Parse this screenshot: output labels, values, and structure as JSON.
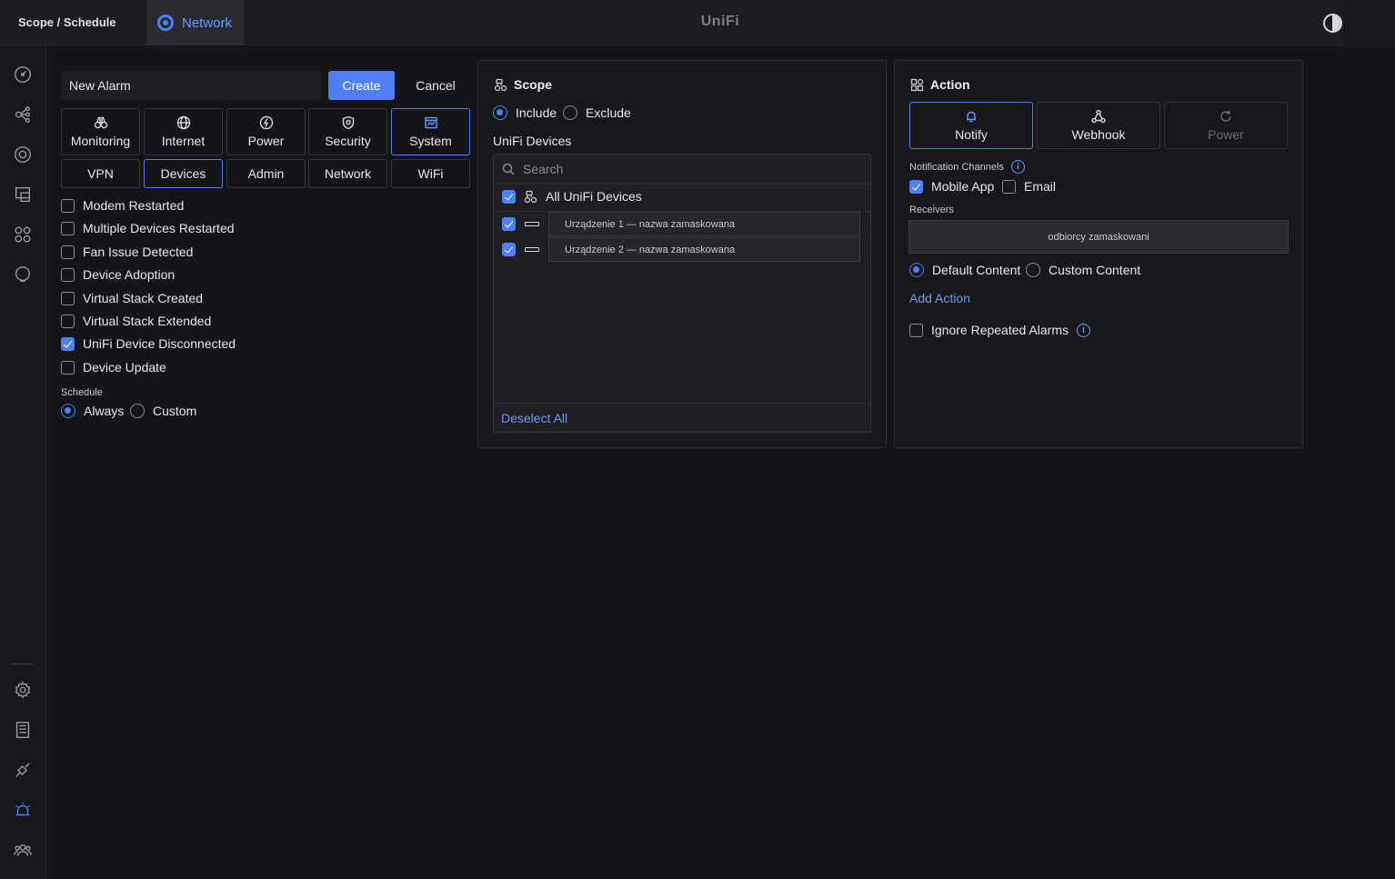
{
  "topbar": {
    "breadcrumb": "Scope / Schedule",
    "app_tab": "Network",
    "brand": "UniFi"
  },
  "sidebar": {
    "items": [
      {
        "icon": "dashboard-icon"
      },
      {
        "icon": "topology-icon"
      },
      {
        "icon": "devices-icon"
      },
      {
        "icon": "client-devices-icon"
      },
      {
        "icon": "apps-icon"
      },
      {
        "icon": "insights-icon"
      },
      {
        "icon": "settings-icon"
      },
      {
        "icon": "logs-icon"
      },
      {
        "icon": "integrations-icon"
      },
      {
        "icon": "alarm-icon",
        "active": true
      },
      {
        "icon": "users-icon"
      }
    ]
  },
  "form": {
    "alarm_name": "New Alarm",
    "create_label": "Create",
    "cancel_label": "Cancel"
  },
  "categories": [
    {
      "label": "Monitoring",
      "icon": "binoculars-icon"
    },
    {
      "label": "Internet",
      "icon": "globe-icon"
    },
    {
      "label": "Power",
      "icon": "lightning-icon"
    },
    {
      "label": "Security",
      "icon": "shield-icon"
    },
    {
      "label": "System",
      "icon": "window-icon",
      "selected": true
    }
  ],
  "subcategories": [
    {
      "label": "VPN"
    },
    {
      "label": "Devices",
      "selected": true
    },
    {
      "label": "Admin"
    },
    {
      "label": "Network"
    },
    {
      "label": "WiFi"
    }
  ],
  "events": [
    {
      "label": "Modem Restarted",
      "checked": false
    },
    {
      "label": "Multiple Devices Restarted",
      "checked": false
    },
    {
      "label": "Fan Issue Detected",
      "checked": false
    },
    {
      "label": "Device Adoption",
      "checked": false
    },
    {
      "label": "Virtual Stack Created",
      "checked": false
    },
    {
      "label": "Virtual Stack Extended",
      "checked": false
    },
    {
      "label": "UniFi Device Disconnected",
      "checked": true
    },
    {
      "label": "Device Update",
      "checked": false
    }
  ],
  "schedule": {
    "label": "Schedule",
    "always": "Always",
    "custom": "Custom",
    "selected": "always"
  },
  "scope": {
    "title": "Scope",
    "include": "Include",
    "exclude": "Exclude",
    "selected": "include",
    "devices_label": "UniFi Devices",
    "search_placeholder": "Search",
    "all_devices": "All UniFi Devices",
    "devices": [
      {
        "name": "Urządzenie 1 — nazwa zamaskowana",
        "checked": true
      },
      {
        "name": "Urządzenie 2 — nazwa zamaskowana",
        "checked": true
      }
    ],
    "deselect_all": "Deselect All"
  },
  "action": {
    "title": "Action",
    "buttons": [
      {
        "label": "Notify",
        "icon": "bell-icon",
        "selected": true
      },
      {
        "label": "Webhook",
        "icon": "webhook-icon"
      },
      {
        "label": "Power",
        "icon": "refresh-icon",
        "disabled": true
      }
    ],
    "channels_label": "Notification Channels",
    "mobile_app": "Mobile App",
    "email": "Email",
    "receivers_label": "Receivers",
    "receivers_value": "odbiorcy zamaskowani",
    "default_content": "Default Content",
    "custom_content": "Custom Content",
    "add_action": "Add Action",
    "ignore_repeated": "Ignore Repeated Alarms"
  },
  "colors": {
    "accent": "#4f7ff5",
    "link": "#6c9bff",
    "background": "#141518"
  }
}
